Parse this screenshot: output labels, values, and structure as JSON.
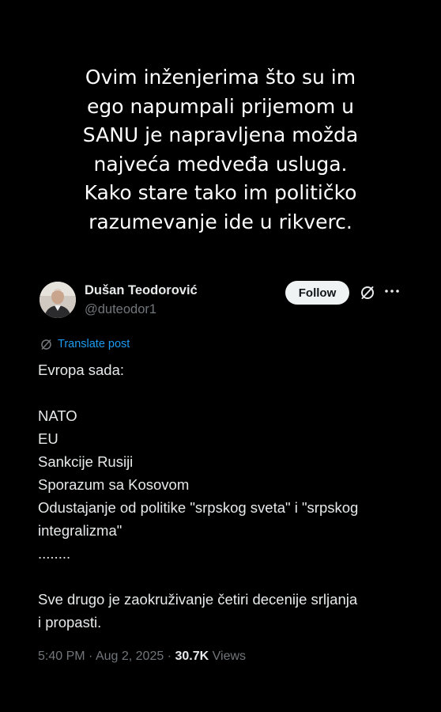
{
  "caption": {
    "lines": [
      "Ovim inženjerima što su im",
      "ego napumpali  prijemom u",
      "SANU je napravljena možda",
      "najveća medveđa usluga.",
      "Kako stare tako im političko",
      "razumevanje ide u rikverc."
    ]
  },
  "tweet": {
    "author_name": "Dušan Teodorović",
    "handle": "@duteodor1",
    "follow_label": "Follow",
    "translate_label": "Translate post",
    "body_lines": [
      "Evropa sada:",
      "",
      "NATO",
      "EU",
      "Sankcije Rusiji",
      "Sporazum sa Kosovom",
      "Odustajanje od politike \"srpskog sveta\" i \"srpskog",
      "integralizma\"",
      "........",
      "",
      "Sve drugo je zaokruživanje četiri decenije srljanja",
      "i propasti."
    ],
    "time": "5:40 PM",
    "date": "Aug 2, 2025",
    "views_count": "30.7K",
    "views_label": "Views",
    "separator": "·"
  },
  "colors": {
    "background": "#000000",
    "text_primary": "#e7e9ea",
    "text_secondary": "#71767b",
    "link": "#1d9bf0",
    "follow_button_bg": "#eff3f4"
  },
  "icons": {
    "grok": "grok-icon",
    "more": "more-icon",
    "translate": "translate-icon"
  }
}
